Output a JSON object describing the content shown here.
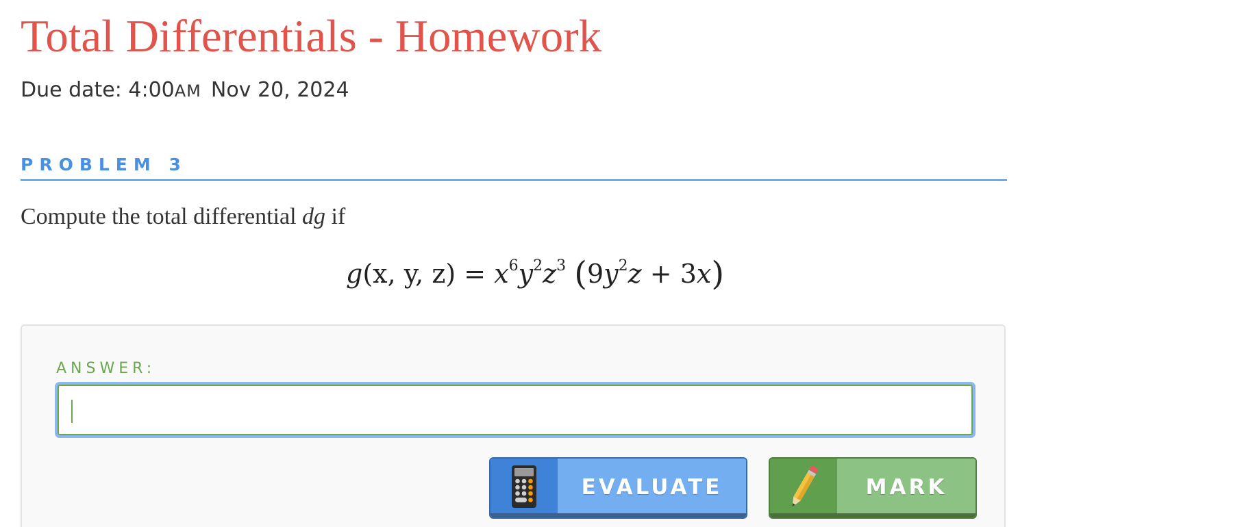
{
  "header": {
    "title": "Total Differentials - Homework",
    "due_prefix": "Due date: 4:00",
    "due_ampm": "AM",
    "due_date": "Nov 20, 2024"
  },
  "problem": {
    "label": "PROBLEM 3",
    "prompt_before": "Compute the total differential",
    "prompt_var": "dg",
    "prompt_after": "if",
    "equation": {
      "lhs_fn": "g",
      "lhs_args": "(x, y, z)",
      "equals": "=",
      "x_base": "x",
      "x_exp": "6",
      "y_base": "y",
      "y_exp": "2",
      "z_base": "z",
      "z_exp": "3",
      "paren_open": "(",
      "inner_coef": "9",
      "inner_y": "y",
      "inner_y_exp": "2",
      "inner_z": "z",
      "plus": "+",
      "inner_term": "3",
      "inner_x": "x",
      "paren_close": ")"
    }
  },
  "answer": {
    "label": "ANSWER:",
    "value": ""
  },
  "buttons": {
    "evaluate_label": "EVALUATE",
    "evaluate_icon": "calculator-icon",
    "mark_label": "MARK",
    "mark_icon": "pencil-icon"
  },
  "colors": {
    "title": "#e0544b",
    "problem_accent": "#4a90e2",
    "answer_accent": "#6aa84f",
    "evaluate_button": "#73aef0",
    "mark_button": "#8cc283"
  }
}
